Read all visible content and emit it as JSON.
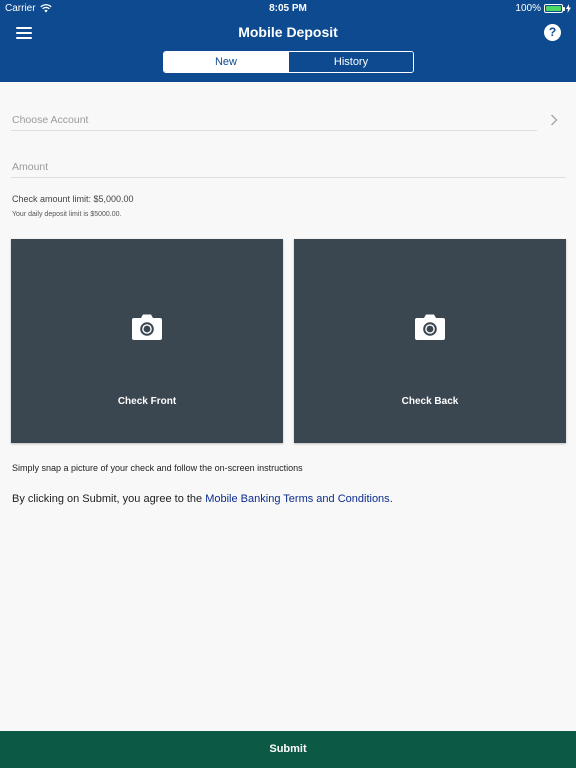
{
  "status_bar": {
    "carrier": "Carrier",
    "time": "8:05 PM",
    "battery": "100%",
    "battery_color": "#4cd964"
  },
  "header": {
    "title": "Mobile Deposit",
    "menu_icon": "hamburger-menu-icon",
    "help_icon": "question-mark-icon",
    "help_glyph": "?",
    "tabs": [
      {
        "label": "New",
        "active": true
      },
      {
        "label": "History",
        "active": false
      }
    ],
    "background_color": "#0d4a8f"
  },
  "form": {
    "account_placeholder": "Choose Account",
    "amount_placeholder": "Amount",
    "limit_text": "Check amount limit: $5,000.00",
    "daily_limit_text": "Your daily deposit limit is $5000.00."
  },
  "capture": {
    "front_label": "Check Front",
    "back_label": "Check Back",
    "card_color": "#3a4650",
    "icon": "camera-icon"
  },
  "instructions": "Simply snap a picture of your check and follow the on-screen instructions",
  "terms": {
    "prefix": "By clicking on Submit, you agree to the ",
    "link": "Mobile Banking Terms and Conditions",
    "suffix": "."
  },
  "footer": {
    "submit_label": "Submit",
    "color": "#0c5a45"
  }
}
